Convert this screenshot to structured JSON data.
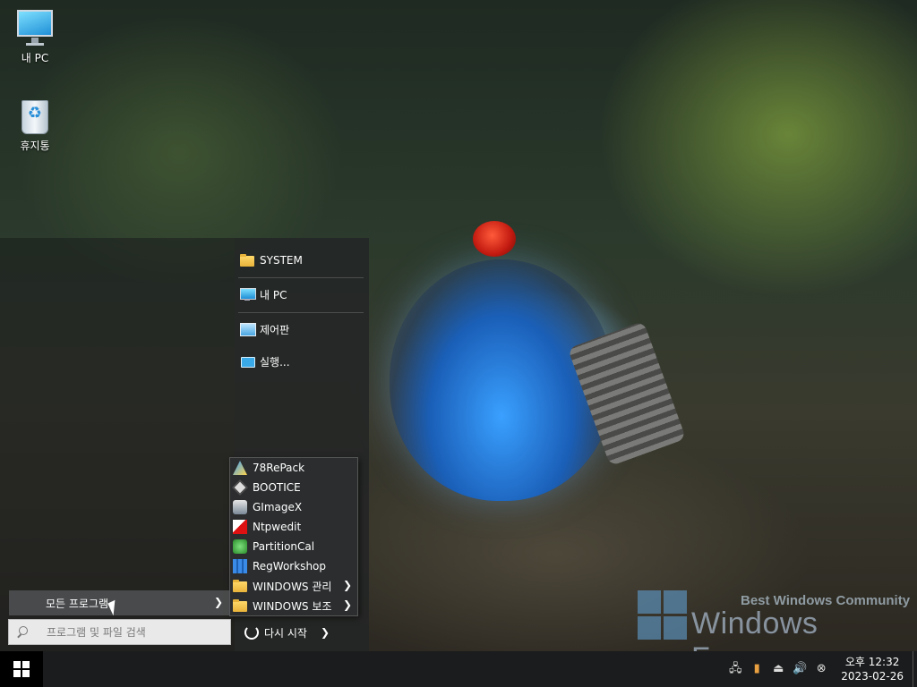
{
  "desktop": {
    "icons": [
      {
        "label": "내 PC",
        "icon": "monitor-icon"
      },
      {
        "label": "휴지통",
        "icon": "recycle-bin-icon"
      }
    ]
  },
  "start_menu": {
    "right_items": [
      {
        "label": "SYSTEM",
        "icon": "folder-icon"
      },
      {
        "label": "내 PC",
        "icon": "monitor-icon"
      },
      {
        "label": "제어판",
        "icon": "control-panel-icon"
      },
      {
        "label": "실행...",
        "icon": "run-icon"
      }
    ],
    "all_programs_label": "모든 프로그램",
    "search_placeholder": "프로그램 및 파일 검색",
    "restart_label": "다시 시작",
    "submenu": [
      {
        "label": "78RePack",
        "icon": "78repack-icon",
        "has_arrow": false
      },
      {
        "label": "BOOTICE",
        "icon": "bootice-icon",
        "has_arrow": false
      },
      {
        "label": "GImageX",
        "icon": "gimagex-icon",
        "has_arrow": false
      },
      {
        "label": "Ntpwedit",
        "icon": "ntpwedit-icon",
        "has_arrow": false
      },
      {
        "label": "PartitionCal",
        "icon": "partitioncal-icon",
        "has_arrow": false
      },
      {
        "label": "RegWorkshop",
        "icon": "regworkshop-icon",
        "has_arrow": false
      },
      {
        "label": "WINDOWS 관리",
        "icon": "folder-icon",
        "has_arrow": true
      },
      {
        "label": "WINDOWS 보조",
        "icon": "folder-icon",
        "has_arrow": true
      }
    ]
  },
  "watermark": {
    "top": "Best Windows Community",
    "main": "Windows Forum"
  },
  "taskbar": {
    "clock_time": "오후 12:32",
    "clock_date": "2023-02-26"
  },
  "colors": {
    "taskbar": "#1b1c1d",
    "menu_right": "#232526",
    "folder": "#ffd86a",
    "accent_blue": "#1f8fd6"
  }
}
